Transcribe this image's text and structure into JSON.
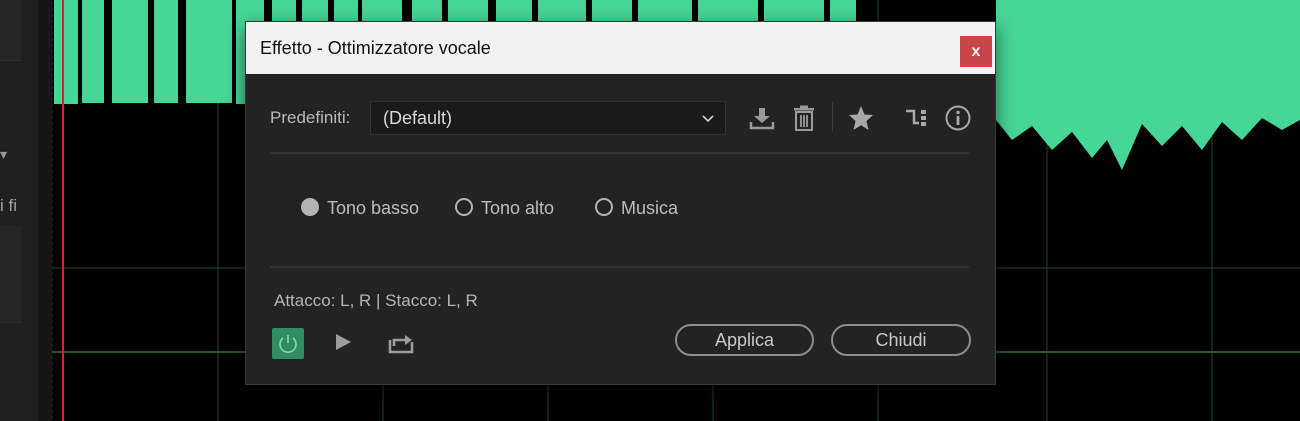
{
  "dialog": {
    "title": "Effetto - Ottimizzatore vocale",
    "close_label": "x"
  },
  "preset": {
    "label": "Predefiniti:",
    "selected": "(Default)"
  },
  "toolbar_icons": [
    "download-preset-icon",
    "delete-preset-icon",
    "favorite-star-icon",
    "routing-icon",
    "info-icon"
  ],
  "mode": {
    "options": [
      "Tono basso",
      "Tono alto",
      "Musica"
    ],
    "selected": "Tono basso"
  },
  "status_text": "Attacco: L, R | Stacco: L, R",
  "controls": {
    "power_state": "on",
    "apply_label": "Applica",
    "close_label": "Chiudi"
  },
  "background": {
    "left_panel_text": "i fi",
    "waveform_color": "#46d696"
  },
  "colors": {
    "accent_green": "#2f8d62",
    "close_red": "#c9464a",
    "waveform_green": "#46d696"
  }
}
